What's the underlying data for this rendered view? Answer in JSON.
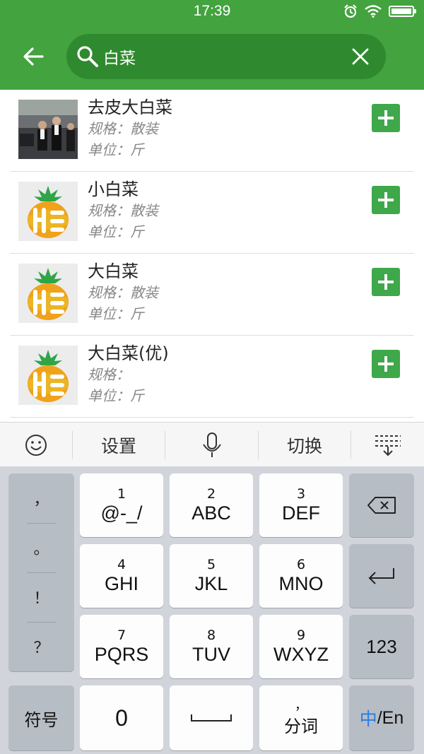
{
  "status_bar": {
    "time": "17:39"
  },
  "search": {
    "query": "白菜"
  },
  "results": [
    {
      "name": "去皮大白菜",
      "spec": "规格：散装",
      "unit": "单位：斤",
      "image": "photo"
    },
    {
      "name": "小白菜",
      "spec": "规格：散装",
      "unit": "单位：斤",
      "image": "pineapple-logo"
    },
    {
      "name": "大白菜",
      "spec": "规格：散装",
      "unit": "单位：斤",
      "image": "pineapple-logo"
    },
    {
      "name": "大白菜(优)",
      "spec": "规格：",
      "unit": "单位：斤",
      "image": "pineapple-logo"
    }
  ],
  "keyboard_toolbar": {
    "settings": "设置",
    "switch": "切换"
  },
  "keyboard": {
    "punctuation": [
      "，",
      "。",
      "！",
      "？"
    ],
    "keys": [
      {
        "num": "1",
        "letters": "@-_/"
      },
      {
        "num": "2",
        "letters": "ABC"
      },
      {
        "num": "3",
        "letters": "DEF"
      },
      {
        "num": "4",
        "letters": "GHI"
      },
      {
        "num": "5",
        "letters": "JKL"
      },
      {
        "num": "6",
        "letters": "MNO"
      },
      {
        "num": "7",
        "letters": "PQRS"
      },
      {
        "num": "8",
        "letters": "TUV"
      },
      {
        "num": "9",
        "letters": "WXYZ"
      }
    ],
    "numbers_key": "123",
    "symbols_key": "符号",
    "zero_key": "0",
    "segment_key_top": "，",
    "segment_key": "分词",
    "lang_active": "中",
    "lang_rest": "/En"
  },
  "colors": {
    "brand_green": "#43a33f",
    "add_green": "#3fa84a",
    "lang_blue": "#2d7de0"
  }
}
